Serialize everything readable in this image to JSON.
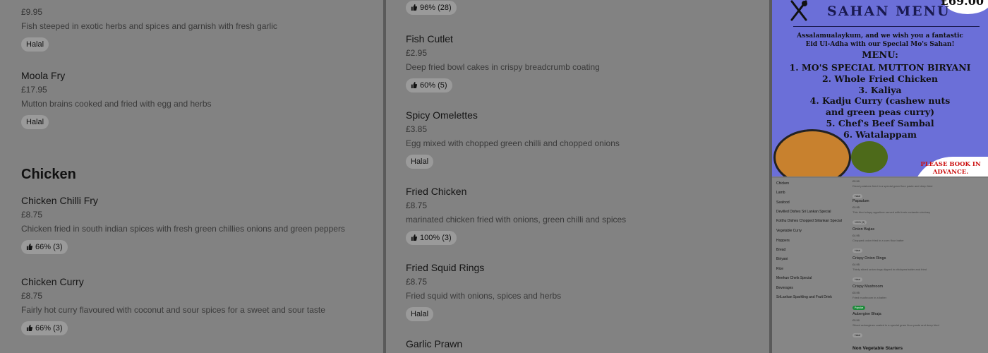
{
  "left_column": {
    "items": [
      {
        "name": "",
        "price": "£9.95",
        "description": "Fish steeped in exotic herbs and spices and garnish with fresh garlic",
        "tag": "Halal"
      },
      {
        "name": "Moola Fry",
        "price": "£17.95",
        "description": "Mutton brains cooked and fried with egg and herbs",
        "tag": "Halal"
      }
    ],
    "section_title": "Chicken",
    "chicken_items": [
      {
        "name": "Chicken Chilli Fry",
        "price": "£8.75",
        "description": "Chicken fried in south indian spices with fresh green chillies onions and green peppers",
        "tag": "66% (3)"
      },
      {
        "name": "Chicken Curry",
        "price": "£8.75",
        "description": "Fairly hot curry flavoured with coconut and sour spices for a sweet and sour taste",
        "tag": "66% (3)"
      }
    ]
  },
  "middle_column": {
    "top_tag": "96% (28)",
    "items": [
      {
        "name": "Fish Cutlet",
        "price": "£2.95",
        "description": "Deep fried bowl cakes in crispy breadcrumb coating",
        "tag": "60% (5)"
      },
      {
        "name": "Spicy Omelettes",
        "price": "£3.85",
        "description": "Egg mixed with chopped green chilli and chopped onions",
        "tag": "Halal"
      },
      {
        "name": "Fried Chicken",
        "price": "£8.75",
        "description": "marinated chicken fried with onions, green chilli and spices",
        "tag": "100% (3)"
      },
      {
        "name": "Fried Squid Rings",
        "price": "£8.75",
        "description": "Fried squid with onions, spices and herbs",
        "tag": "Halal"
      },
      {
        "name": "Garlic Prawn",
        "price": "",
        "description": "",
        "tag": ""
      }
    ]
  },
  "poster": {
    "price": "£69.00",
    "title": "SAHAN MENU",
    "greeting_line1": "Assalamualaykum, and we wish you a fantastic",
    "greeting_line2": "Eid Ul-Adha with our Special Mo's Sahan!",
    "menu_label": "MENU:",
    "menu_items": [
      "1. MO'S SPECIAL MUTTON BIRYANI",
      "2. Whole Fried Chicken",
      "3. Kaliya",
      "4. Kadju Curry (cashew nuts",
      "and green peas curry)",
      "5. Chef's Beef Sambal",
      "6. Watalappam"
    ],
    "book_line1": "PLEASE BOOK IN",
    "book_line2": "ADVANCE.",
    "accent_color": "#6b6fd8"
  },
  "mini_screenshot": {
    "nav": [
      "Chicken",
      "Lamb",
      "Seafood",
      "Devilled Dishes Sri Lankan Special",
      "Kotthu Dishes Chopped Srilankan Special",
      "Vegetable Curry",
      "Hoppers",
      "Bread",
      "Biriyani",
      "Rice",
      "Meehun Chefs Special",
      "Beverages",
      "SriLankan Sparkling and Fruit Drink"
    ],
    "items": [
      {
        "name": "",
        "price": "£5.50",
        "description": "Diced potatoes fried in a special gram flour paste and deep fried",
        "tag": "Halal"
      },
      {
        "name": "Papadum",
        "price": "£0.95",
        "description": "Thin fried crispy appetizer served with fresh coriander chutney",
        "tag": "100% (3)"
      },
      {
        "name": "Onion Bajias",
        "price": "£4.95",
        "description": "Chopped onion fried in a corn flour batter",
        "tag": "Halal"
      },
      {
        "name": "Crispy Onion Rings",
        "price": "£4.95",
        "description": "Thinly sliced onion rings dipped in chickpea batter and fried",
        "tag": "Halal"
      },
      {
        "name": "Crispy Mushroom",
        "price": "£5.95",
        "description": "Fried mushroom in a batter",
        "tag": "Popular"
      },
      {
        "name": "Aubergine Bhaja",
        "price": "£5.50",
        "description": "Sliced aubergines coated in a special gram flour paste and deep fried",
        "tag": "Halal"
      }
    ],
    "section_title": "Non Vegetable Starters"
  }
}
